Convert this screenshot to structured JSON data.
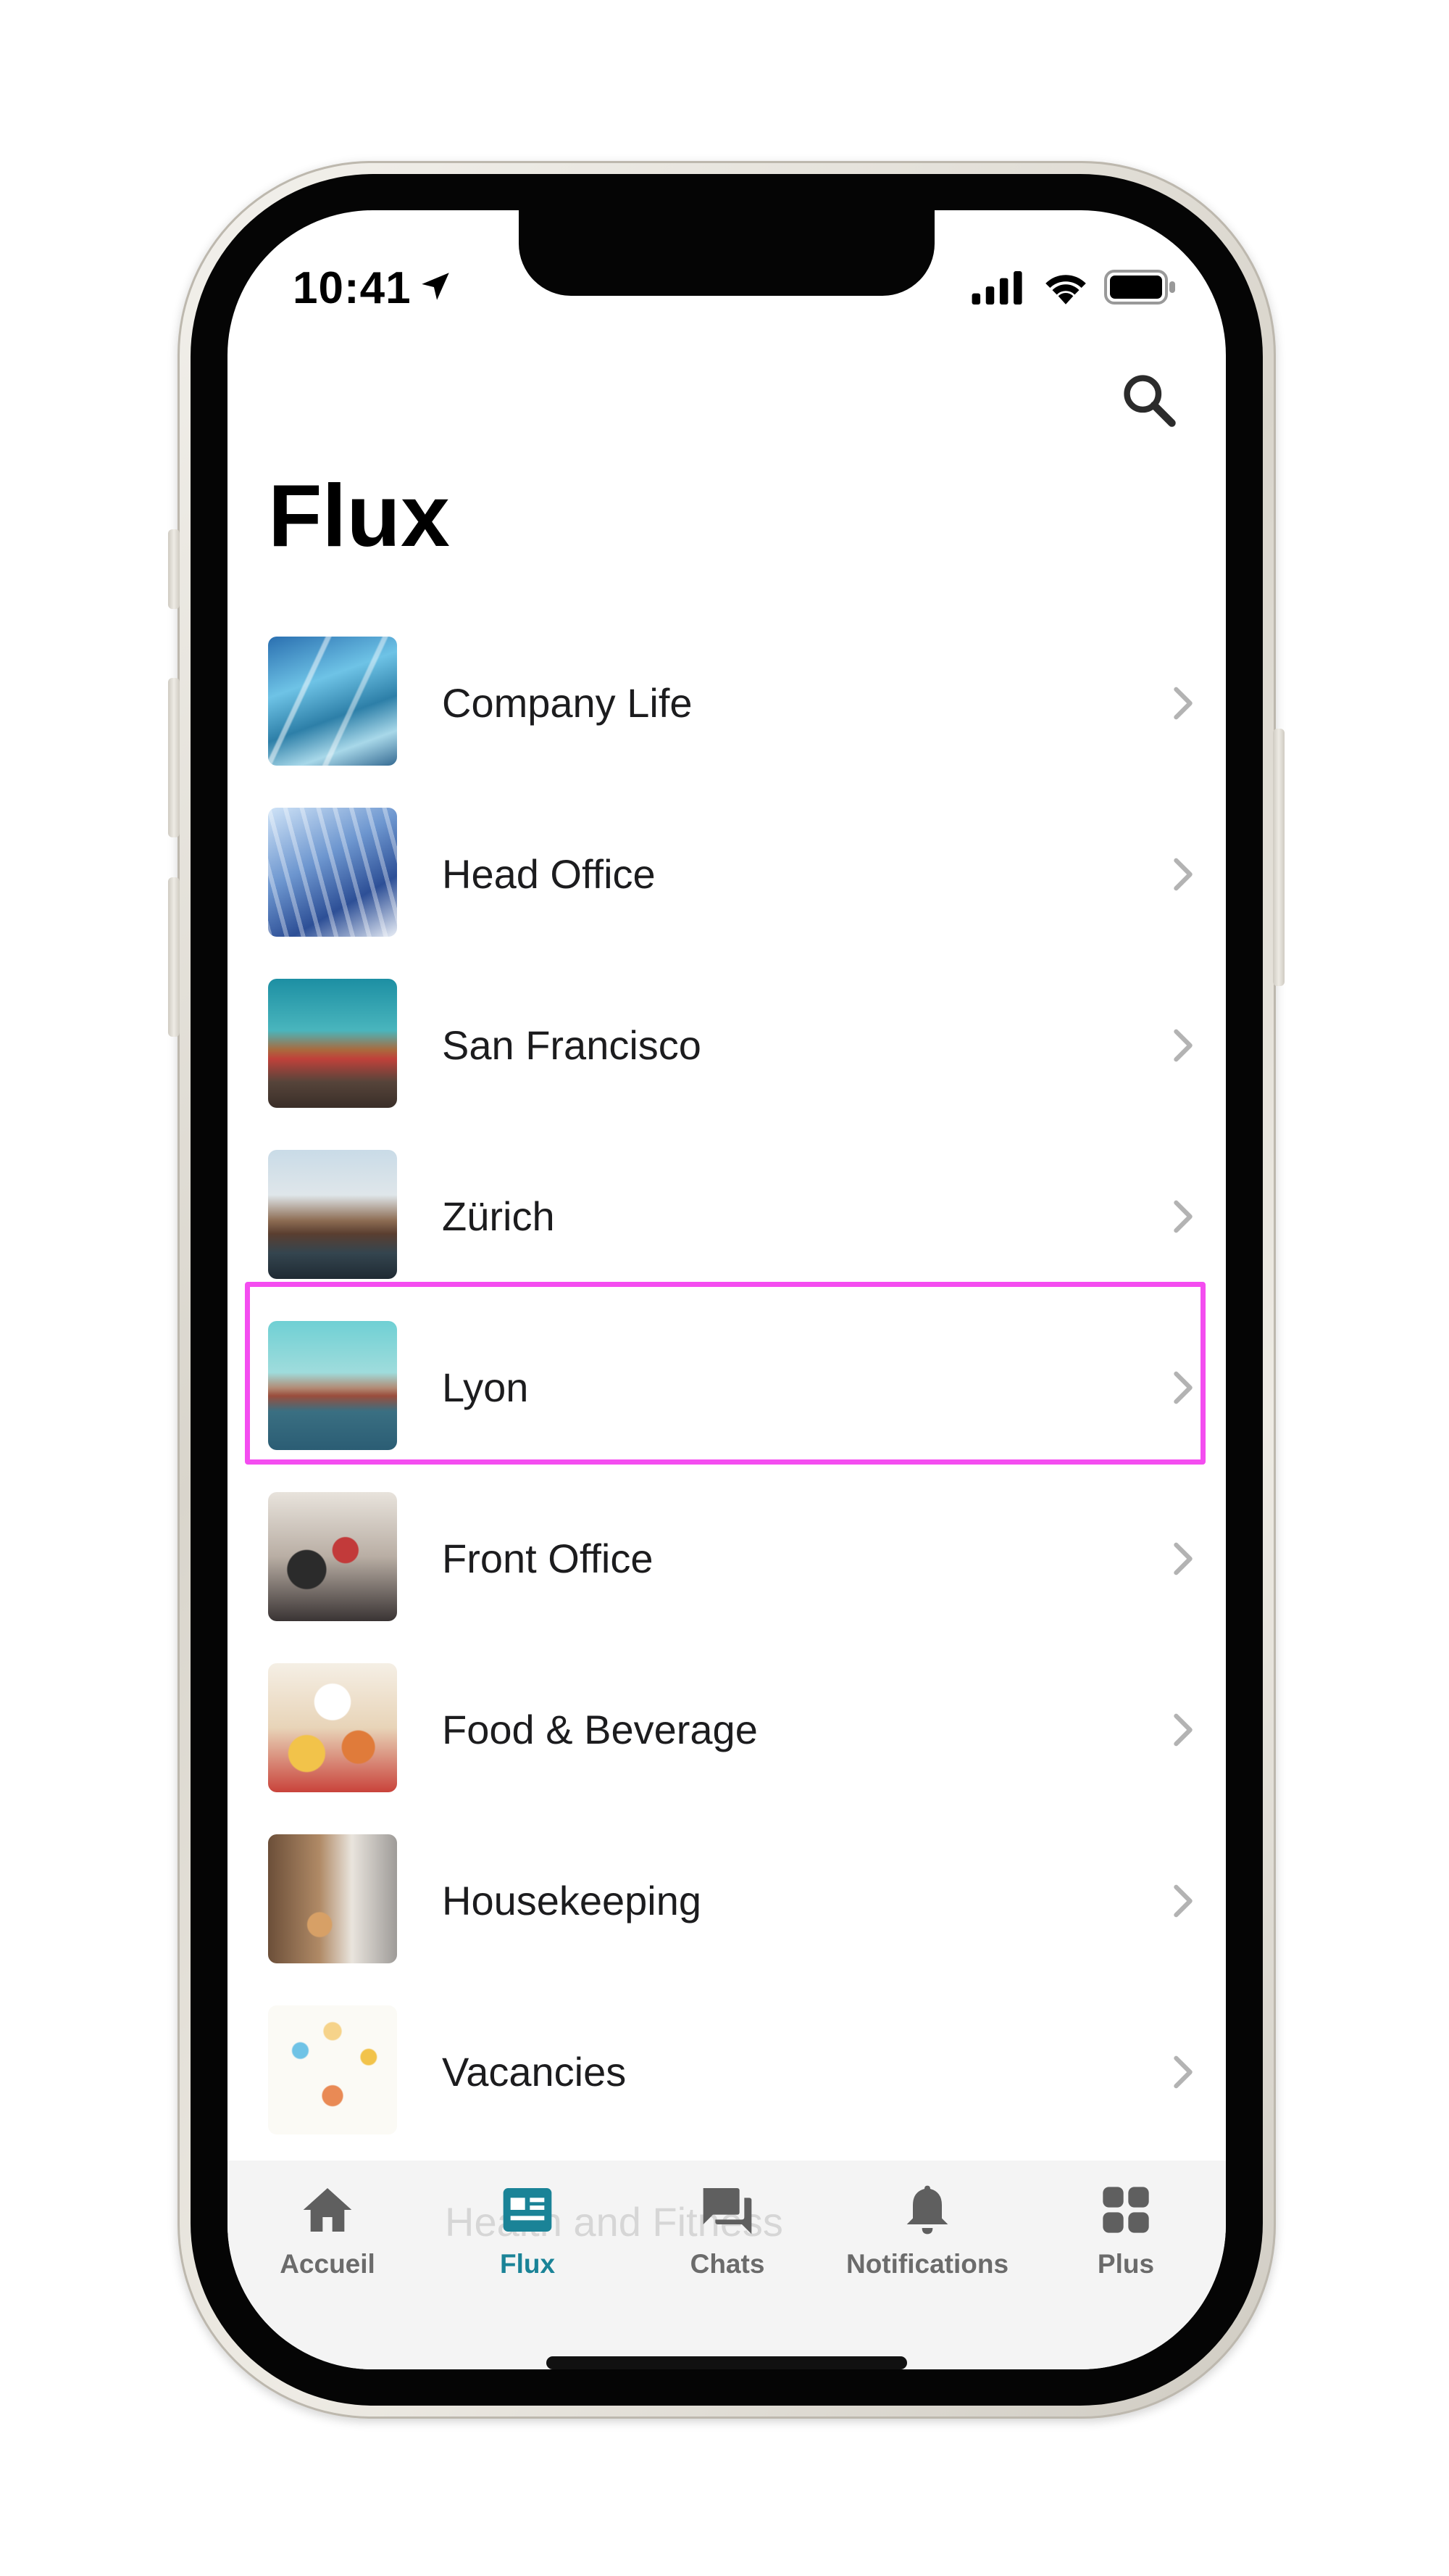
{
  "status_bar": {
    "time": "10:41"
  },
  "header": {
    "title": "Flux",
    "search_icon": "search-icon"
  },
  "feeds": [
    {
      "label": "Company Life",
      "thumb": "t-company"
    },
    {
      "label": "Head Office",
      "thumb": "t-head"
    },
    {
      "label": "San Francisco",
      "thumb": "t-sf"
    },
    {
      "label": "Zürich",
      "thumb": "t-zurich"
    },
    {
      "label": "Lyon",
      "thumb": "t-lyon"
    },
    {
      "label": "Front Office",
      "thumb": "t-front"
    },
    {
      "label": "Food & Beverage",
      "thumb": "t-food"
    },
    {
      "label": "Housekeeping",
      "thumb": "t-house"
    },
    {
      "label": "Vacancies",
      "thumb": "t-vac"
    }
  ],
  "hidden_row_peek": "Health and Fitness",
  "tab_bar": {
    "active": "Flux",
    "accent_color": "#1a8397",
    "tabs": [
      {
        "label": "Accueil",
        "icon": "home-icon"
      },
      {
        "label": "Flux",
        "icon": "feed-icon"
      },
      {
        "label": "Chats",
        "icon": "chat-icon"
      },
      {
        "label": "Notifications",
        "icon": "bell-icon"
      },
      {
        "label": "Plus",
        "icon": "grid-icon"
      }
    ]
  },
  "highlight_color": "#f44df0"
}
